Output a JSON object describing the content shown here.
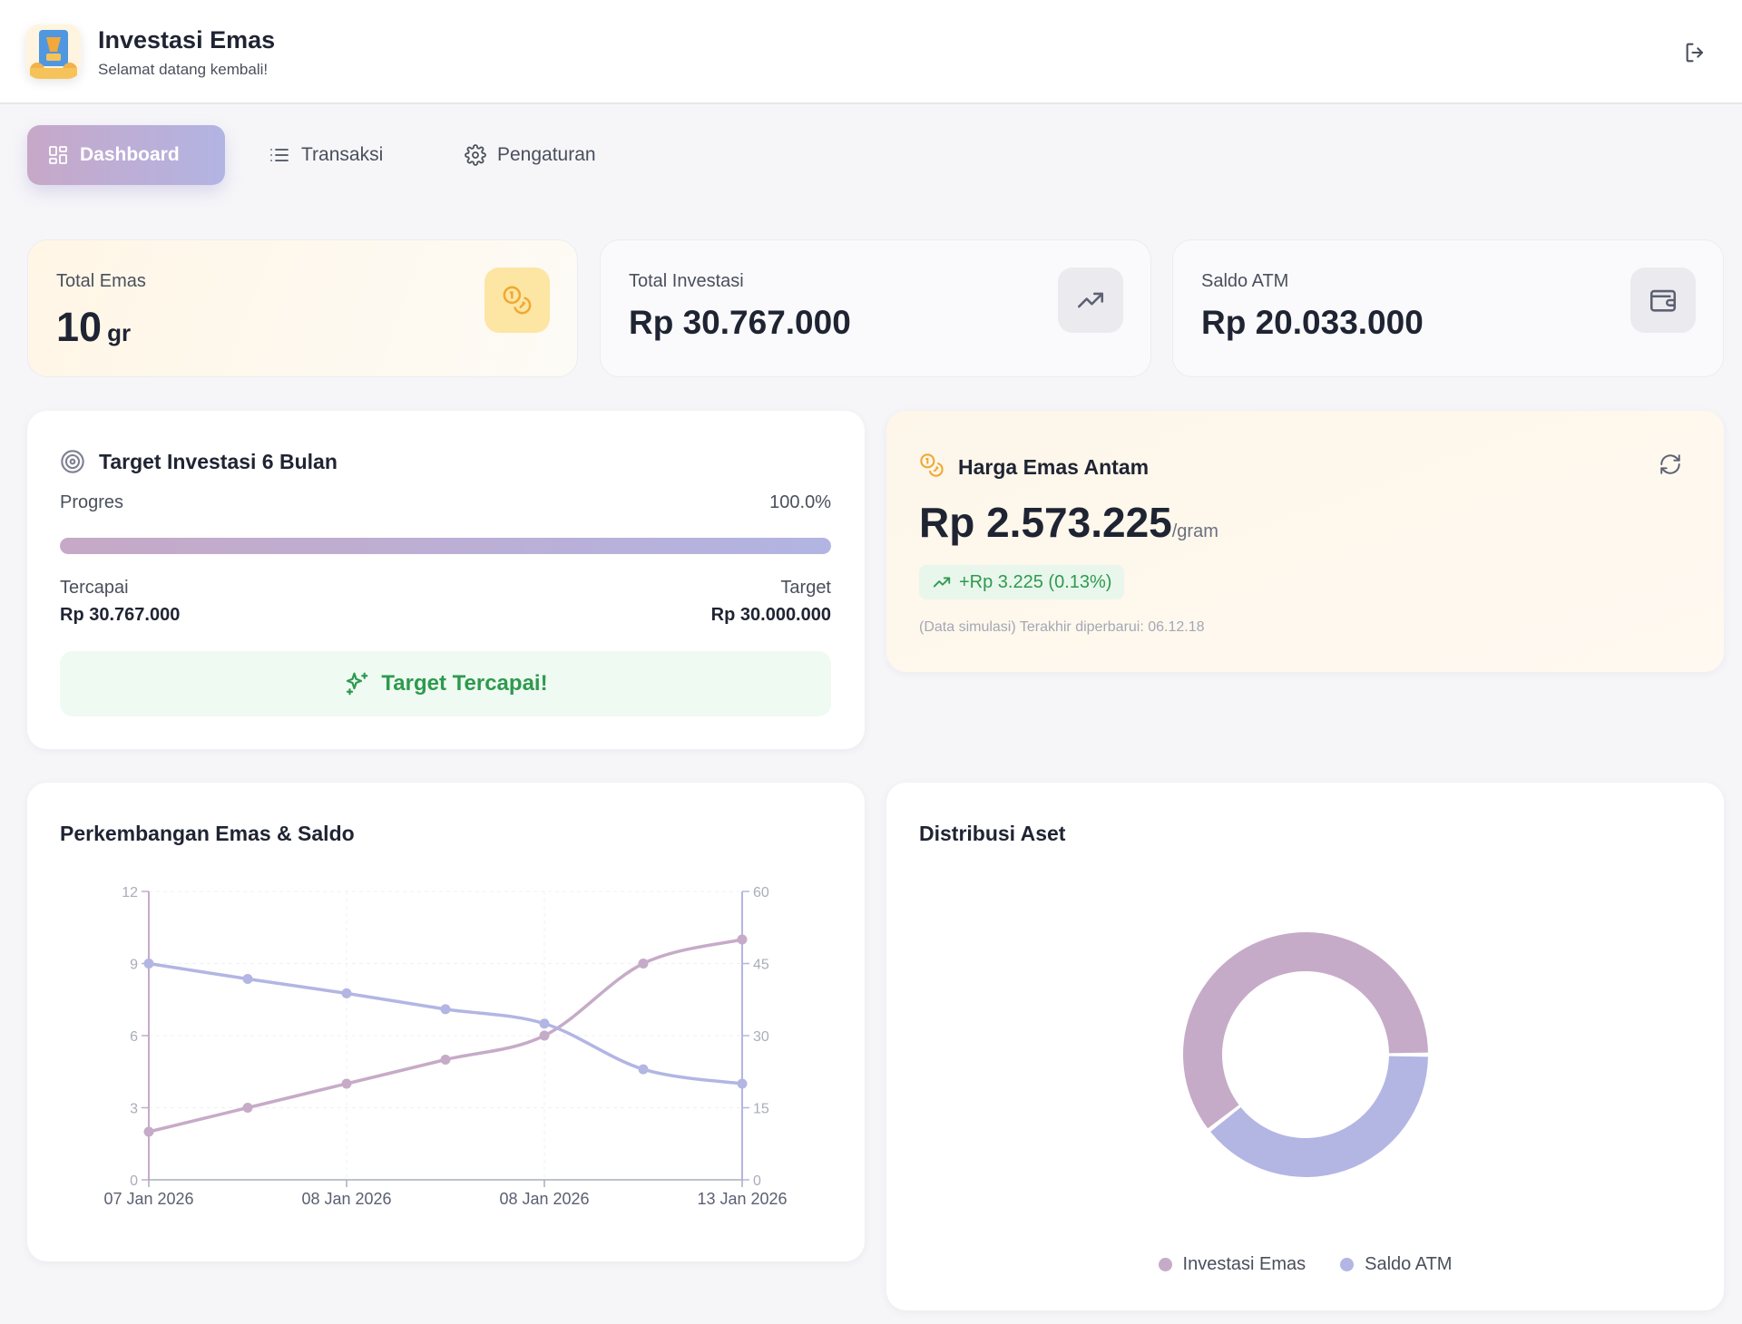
{
  "header": {
    "title": "Investasi Emas",
    "subtitle": "Selamat datang kembali!"
  },
  "nav": {
    "tabs": [
      {
        "label": "Dashboard",
        "icon": "dashboard-icon",
        "active": true
      },
      {
        "label": "Transaksi",
        "icon": "list-icon",
        "active": false
      },
      {
        "label": "Pengaturan",
        "icon": "gear-icon",
        "active": false
      }
    ]
  },
  "stats": {
    "total_emas": {
      "label": "Total Emas",
      "value": "10",
      "unit": "gr",
      "icon": "coins-icon"
    },
    "total_investasi": {
      "label": "Total Investasi",
      "value": "Rp 30.767.000",
      "icon": "trending-up-icon"
    },
    "saldo_atm": {
      "label": "Saldo ATM",
      "value": "Rp 20.033.000",
      "icon": "wallet-icon"
    }
  },
  "target": {
    "title": "Target Investasi 6 Bulan",
    "progress_label": "Progres",
    "progress_text": "100.0%",
    "progress_fraction": 1.0,
    "achieved_label": "Tercapai",
    "achieved_value": "Rp 30.767.000",
    "target_label": "Target",
    "target_value": "Rp 30.000.000",
    "status": "Target Tercapai!"
  },
  "gold_price": {
    "title": "Harga Emas Antam",
    "price": "Rp 2.573.225",
    "unit": "/gram",
    "change": "+Rp 3.225 (0.13%)",
    "note": "(Data simulasi) Terakhir diperbarui: 06.12.18"
  },
  "growth_chart": {
    "title": "Perkembangan Emas & Saldo"
  },
  "distribution": {
    "title": "Distribusi Aset"
  },
  "colors": {
    "series_emas": "#c6abc8",
    "series_saldo": "#b3b5e3",
    "success": "#2e9a4e",
    "gold_accent": "#f0a933"
  },
  "chart_data": [
    {
      "type": "line",
      "title": "Perkembangan Emas & Saldo",
      "x": [
        "07 Jan 2026",
        "",
        "08 Jan 2026",
        "",
        "08 Jan 2026",
        "",
        "13 Jan 2026"
      ],
      "x_tick_labels": [
        "07 Jan 2026",
        "08 Jan 2026",
        "08 Jan 2026",
        "13 Jan 2026"
      ],
      "left_axis": {
        "ylim": [
          0,
          12
        ],
        "ticks": [
          "0",
          "3",
          "6",
          "9",
          "12"
        ]
      },
      "right_axis": {
        "ylim": [
          0,
          60
        ],
        "ticks": [
          "0",
          "15",
          "30",
          "45",
          "60"
        ]
      },
      "series": [
        {
          "axis": "left",
          "color": "#c6abc8",
          "values": [
            2,
            3,
            4,
            5,
            6,
            9,
            10
          ]
        },
        {
          "axis": "right",
          "color": "#b3b5e3",
          "values": [
            45,
            41.8,
            38.8,
            35.5,
            32.5,
            23,
            20
          ]
        }
      ],
      "grid": true
    },
    {
      "type": "pie",
      "title": "Distribusi Aset",
      "labels": [
        "Investasi Emas",
        "Saldo ATM"
      ],
      "values": [
        30767000,
        20033000
      ],
      "colors": [
        "#c6abc8",
        "#b3b5e3"
      ],
      "donut": true,
      "legend": "bottom"
    }
  ]
}
